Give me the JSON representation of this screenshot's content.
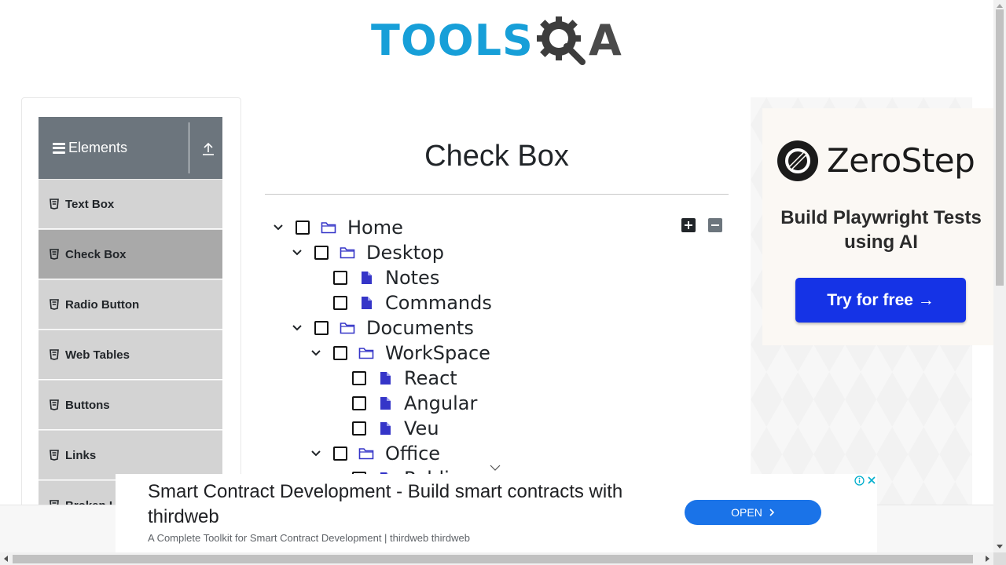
{
  "logo": {
    "text_primary": "TOOLS",
    "text_secondary": "A"
  },
  "sidebar": {
    "group_title": "Elements",
    "items": [
      {
        "label": "Text Box",
        "active": false
      },
      {
        "label": "Check Box",
        "active": true
      },
      {
        "label": "Radio Button",
        "active": false
      },
      {
        "label": "Web Tables",
        "active": false
      },
      {
        "label": "Buttons",
        "active": false
      },
      {
        "label": "Links",
        "active": false
      },
      {
        "label": "Broken Links - Images",
        "active": false
      }
    ]
  },
  "main": {
    "title": "Check Box",
    "tree": [
      {
        "label": "Home",
        "level": 0,
        "type": "folder",
        "expanded": true
      },
      {
        "label": "Desktop",
        "level": 1,
        "type": "folder",
        "expanded": true
      },
      {
        "label": "Notes",
        "level": 2,
        "type": "file"
      },
      {
        "label": "Commands",
        "level": 2,
        "type": "file"
      },
      {
        "label": "Documents",
        "level": 1,
        "type": "folder",
        "expanded": true
      },
      {
        "label": "WorkSpace",
        "level": 2,
        "type": "folder",
        "expanded": true
      },
      {
        "label": "React",
        "level": 3,
        "type": "file"
      },
      {
        "label": "Angular",
        "level": 3,
        "type": "file"
      },
      {
        "label": "Veu",
        "level": 3,
        "type": "file"
      },
      {
        "label": "Office",
        "level": 2,
        "type": "folder",
        "expanded": true
      },
      {
        "label": "Public",
        "level": 3,
        "type": "file"
      }
    ]
  },
  "right_ad": {
    "brand": "ZeroStep",
    "tagline": "Build Playwright Tests using AI",
    "button": "Try for free →"
  },
  "bottom_ad": {
    "headline": "Smart Contract Development - Build smart contracts with thirdweb",
    "subline": "A Complete Toolkit for Smart Contract Development | thirdweb thirdweb",
    "button": "OPEN"
  },
  "colors": {
    "accent_blue": "#179fd8",
    "menu_header": "#6c757d",
    "menu_item": "#d3d3d3",
    "menu_active": "#a9a9a9",
    "tree_icon": "#3535c8",
    "cta_blue": "#1533e6",
    "open_blue": "#1a73e8"
  }
}
